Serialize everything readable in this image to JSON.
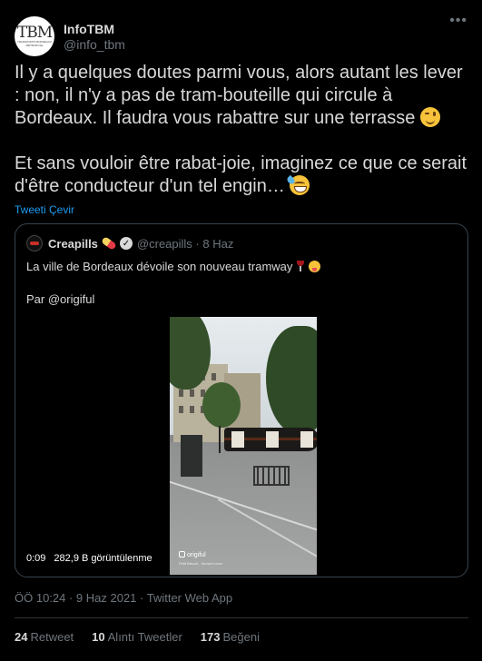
{
  "author": {
    "name": "InfoTBM",
    "handle": "@info_tbm",
    "avatar_logo": "TBM",
    "avatar_sub": "TRANSPORTS BORDEAUX MÉTROPOLE"
  },
  "tweet": {
    "text_part1": "Il y a quelques doutes parmi vous, alors autant les lever : non, il n'y a pas de tram-bouteille qui circule à Bordeaux. Il faudra vous rabattre sur une terrasse ",
    "text_part2": "\n\nEt sans vouloir être rabat-joie, imaginez ce que ce serait d'être conducteur d'un tel engin… ",
    "translate_label": "Tweeti Çevir",
    "timestamp": "ÖÖ 10:24 · 9 Haz 2021 · Twitter Web App"
  },
  "quote": {
    "name": "Creapills",
    "handle": "@creapills · 8 Haz",
    "text_line1": "La ville de Bordeaux dévoile son nouveau tramway ",
    "text_line2": "\n\nPar @origiful",
    "video": {
      "duration": "0:09",
      "views": "282,9 B görüntülenme",
      "watermark": "origiful",
      "watermark_sub": "Petit Biscuit - Sunset Lover"
    }
  },
  "stats": {
    "retweets_count": "24",
    "retweets_label": "Retweet",
    "quotes_count": "10",
    "quotes_label": "Alıntı Tweetler",
    "likes_count": "173",
    "likes_label": "Beğeni"
  },
  "icons": [
    "more-icon",
    "wink-emoji-icon",
    "sweat-smile-emoji-icon",
    "pill-icon",
    "verified-icon",
    "wine-glass-icon",
    "tongue-wink-emoji-icon"
  ],
  "colors": {
    "background": "#000000",
    "link": "#1d9bf0",
    "muted": "#6e767d",
    "border": "#38444d"
  }
}
